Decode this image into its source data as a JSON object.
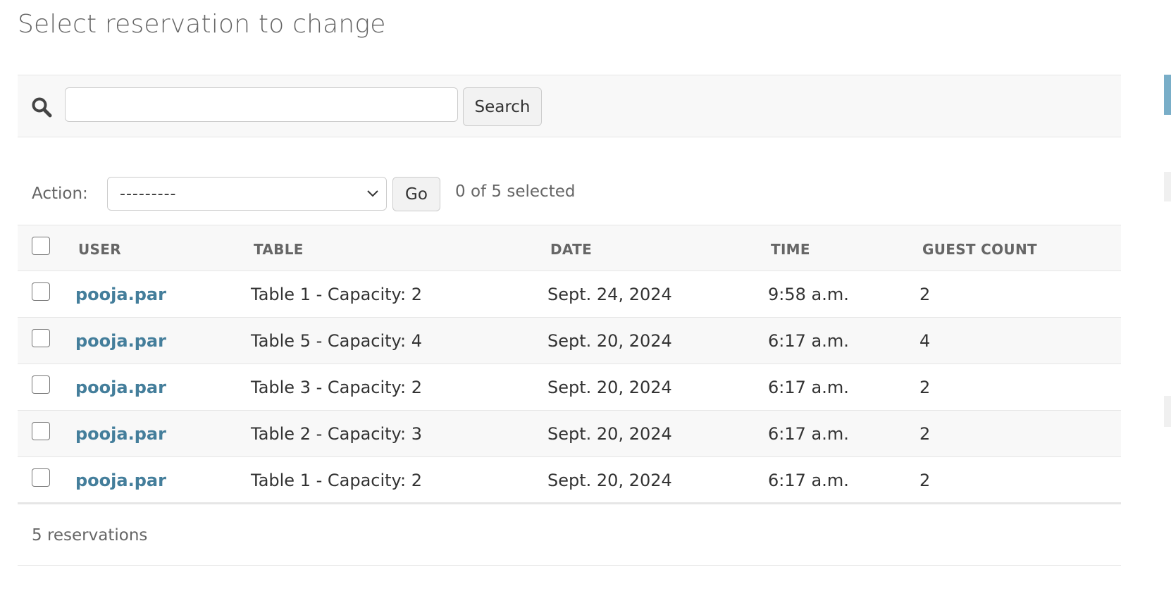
{
  "page": {
    "title": "Select reservation to change"
  },
  "search": {
    "value": "",
    "placeholder": "",
    "button_label": "Search"
  },
  "actions": {
    "label": "Action:",
    "selected_option": "---------",
    "go_label": "Go",
    "selection_counter": "0 of 5 selected"
  },
  "table": {
    "columns": [
      "USER",
      "TABLE",
      "DATE",
      "TIME",
      "GUEST COUNT"
    ],
    "rows": [
      {
        "user": "pooja.par",
        "table": "Table 1 - Capacity: 2",
        "date": "Sept. 24, 2024",
        "time": "9:58 a.m.",
        "guest_count": "2"
      },
      {
        "user": "pooja.par",
        "table": "Table 5 - Capacity: 4",
        "date": "Sept. 20, 2024",
        "time": "6:17 a.m.",
        "guest_count": "4"
      },
      {
        "user": "pooja.par",
        "table": "Table 3 - Capacity: 2",
        "date": "Sept. 20, 2024",
        "time": "6:17 a.m.",
        "guest_count": "2"
      },
      {
        "user": "pooja.par",
        "table": "Table 2 - Capacity: 3",
        "date": "Sept. 20, 2024",
        "time": "6:17 a.m.",
        "guest_count": "2"
      },
      {
        "user": "pooja.par",
        "table": "Table 1 - Capacity: 2",
        "date": "Sept. 20, 2024",
        "time": "6:17 a.m.",
        "guest_count": "2"
      }
    ]
  },
  "paginator": {
    "text": "5 reservations"
  },
  "icons": {
    "search": "search-icon",
    "select_arrow": "chevron-down-icon"
  },
  "colors": {
    "link": "#447e9b",
    "header_bg": "#f8f8f8",
    "scroll_accent": "#79aec8"
  }
}
